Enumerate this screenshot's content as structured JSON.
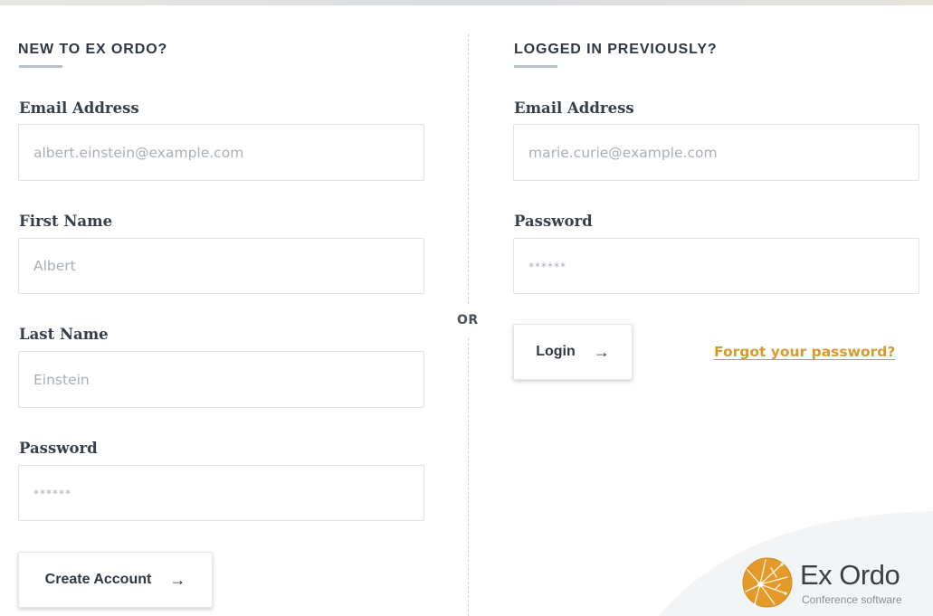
{
  "register": {
    "heading": "NEW TO EX ORDO?",
    "email_label": "Email Address",
    "email_placeholder": "albert.einstein@example.com",
    "first_name_label": "First Name",
    "first_name_placeholder": "Albert",
    "last_name_label": "Last Name",
    "last_name_placeholder": "Einstein",
    "password_label": "Password",
    "password_placeholder": "******",
    "submit_label": "Create Account",
    "submit_icon": "arrow-right-icon"
  },
  "divider": {
    "label": "OR"
  },
  "login": {
    "heading": "LOGGED IN PREVIOUSLY?",
    "email_label": "Email Address",
    "email_placeholder": "marie.curie@example.com",
    "password_label": "Password",
    "password_placeholder": "******",
    "submit_label": "Login",
    "submit_icon": "arrow-right-icon",
    "forgot_link": "Forgot your password?"
  },
  "brand": {
    "name": "Ex Ordo",
    "tagline": "Conference software",
    "logo_icon": "ex-ordo-starburst-logo"
  },
  "colors": {
    "link": "#d79a2f",
    "text": "#37404a",
    "input_border": "#dfe3e8",
    "placeholder": "#a8afb7",
    "logo_orange": "#e39a2b"
  }
}
